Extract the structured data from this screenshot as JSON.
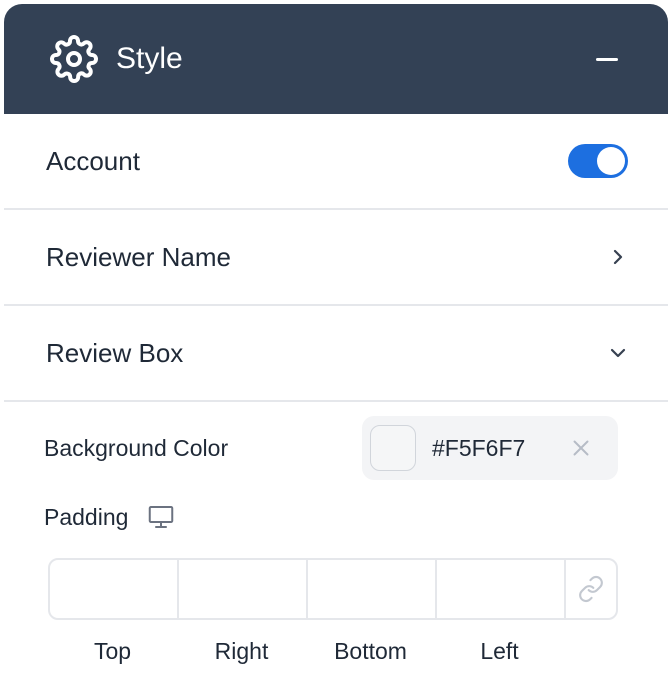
{
  "header": {
    "title": "Style",
    "icon": "gear-icon",
    "collapse_icon": "minus-icon",
    "background_color": "#334155"
  },
  "rows": {
    "account": {
      "label": "Account",
      "enabled": true,
      "toggle_color": "#1D6FE0"
    },
    "reviewer_name": {
      "label": "Reviewer Name",
      "icon": "chevron-right-icon"
    },
    "review_box": {
      "label": "Review Box",
      "icon": "chevron-down-icon"
    }
  },
  "review_box": {
    "background_color": {
      "label": "Background Color",
      "value": "#F5F6F7",
      "clear_icon": "close-icon"
    },
    "padding": {
      "label": "Padding",
      "device_icon": "monitor-icon",
      "link_icon": "link-icon",
      "fields": [
        {
          "caption": "Top",
          "value": ""
        },
        {
          "caption": "Right",
          "value": ""
        },
        {
          "caption": "Bottom",
          "value": ""
        },
        {
          "caption": "Left",
          "value": ""
        }
      ]
    }
  }
}
